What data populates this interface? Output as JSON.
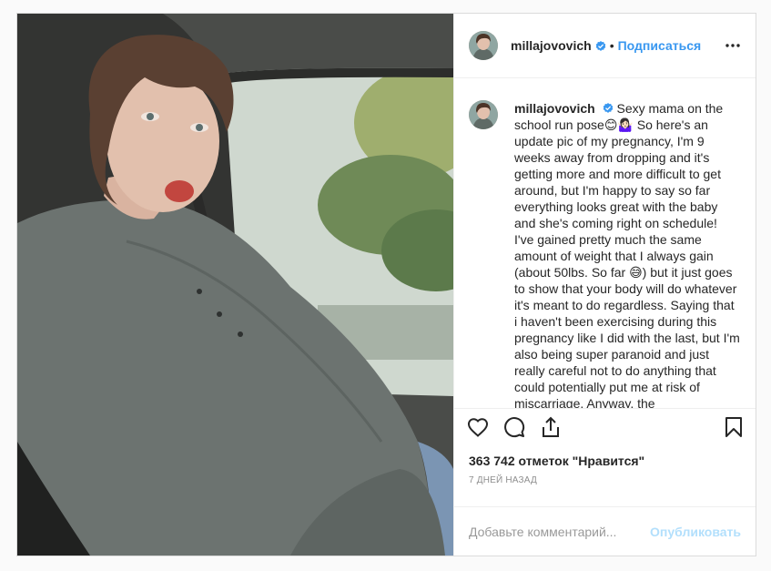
{
  "post": {
    "username": "millajovovich",
    "follow_label": "Подписаться",
    "caption": "Sexy mama on the school run pose😊🤷🏻‍♀️ So here's an update pic of my pregnancy, I'm 9 weeks away from dropping and it's getting more and more difficult to get around, but I'm happy to say so far everything looks great with the baby and she's coming right on schedule! I've gained pretty much the same amount of weight that I always gain (about 50lbs. So far 😅) but it just goes to show that your body will do whatever it's meant to do regardless. Saying that i haven't been exercising during this pregnancy like I did with the last, but I'm also being super paranoid and just really careful not to do anything that could potentially put me at risk of miscarriage. Anyway, the",
    "likes": "363 742 отметок \"Нравится\"",
    "time": "7 дней назад"
  },
  "comment_box": {
    "placeholder": "Добавьте комментарий...",
    "publish_label": "Опубликовать"
  },
  "icons": {
    "verified": "verified-badge-icon",
    "more": "more-options-icon",
    "like": "heart-icon",
    "comment": "comment-icon",
    "share": "share-icon",
    "save": "bookmark-icon"
  },
  "colors": {
    "link_blue": "#3897f0",
    "publish_disabled": "#b2dffc",
    "border": "#dbdbdb"
  }
}
